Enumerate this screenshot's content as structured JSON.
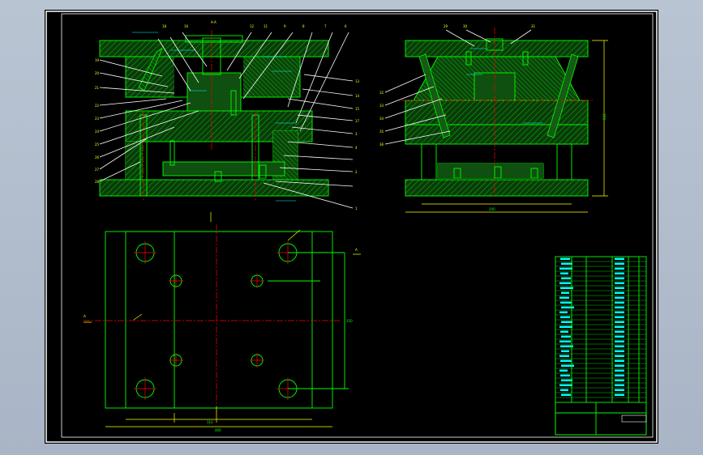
{
  "section_title": "A-A",
  "balloons_top": [
    "18",
    "16",
    "12",
    "11",
    "9",
    "8",
    "7",
    "6",
    "5"
  ],
  "balloons_left": [
    "19",
    "20",
    "21",
    "22",
    "23",
    "24",
    "25",
    "26",
    "27",
    "28"
  ],
  "balloons_right": [
    "13",
    "14",
    "15",
    "17",
    "3",
    "4",
    "2",
    "1"
  ],
  "right_view_labels_top": [
    "29",
    "30",
    "31"
  ],
  "right_view_labels_left": [
    "32",
    "33",
    "34",
    "35",
    "36"
  ],
  "dimensions": {
    "bottom_width": "400",
    "bottom_inner": "310",
    "right_view_width": "200",
    "right_view_height": "245",
    "plate_height": "350"
  },
  "markers": {
    "a1": "A",
    "a2": "A"
  },
  "title_block": {
    "rows": 30,
    "header": "",
    "footer": ""
  },
  "colors": {
    "lines": "#00ff00",
    "text": "#ffff00",
    "center": "#ff0000",
    "outline": "#ffffff",
    "background": "#000000"
  }
}
